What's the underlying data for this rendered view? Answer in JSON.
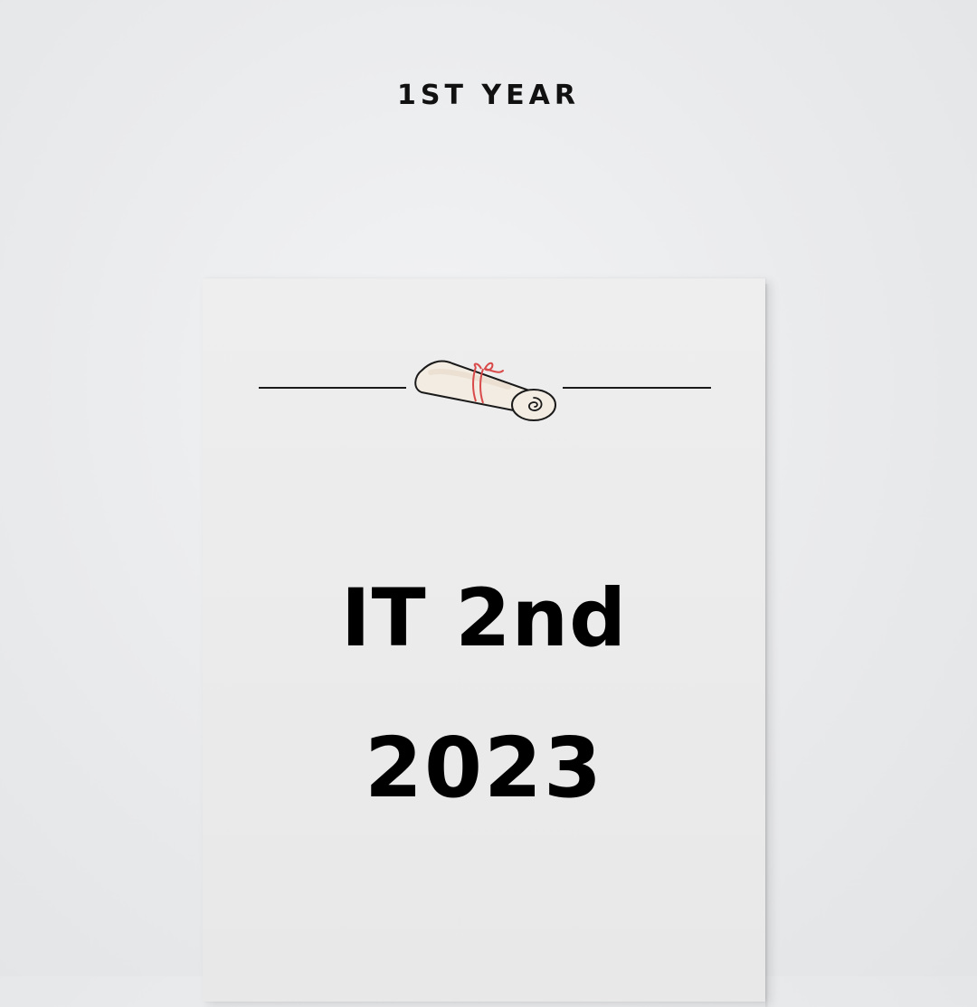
{
  "heading": {
    "top_label": "1ST YEAR"
  },
  "card": {
    "line1": "IT 2nd",
    "line2": "2023",
    "icon": "scroll-icon"
  },
  "colors": {
    "background": "#e9eaec",
    "paper": "#ebebeb",
    "text": "#000000",
    "ribbon": "#d94a4a",
    "scroll_fill": "#f3ece2"
  }
}
